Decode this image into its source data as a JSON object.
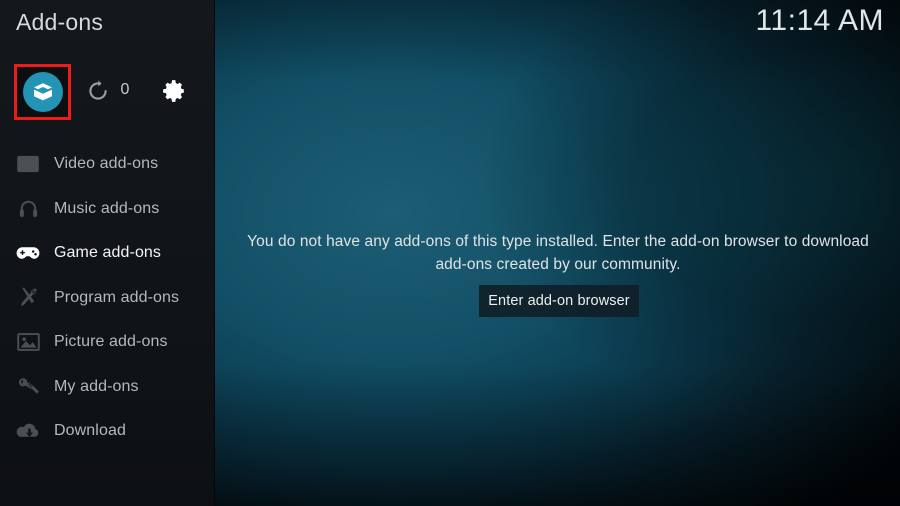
{
  "window": {
    "title": "Add-ons",
    "clock": "11:14 AM"
  },
  "toolbar": {
    "addon_browser": {
      "label": "",
      "icon": "addon-box-icon",
      "highlighted": true,
      "highlight_color": "#ee1b1b",
      "accent_color": "#2494b5"
    },
    "refresh": {
      "label": "",
      "icon": "refresh-icon",
      "count": "0"
    },
    "settings": {
      "label": "",
      "icon": "gear-icon"
    }
  },
  "sidebar": {
    "items": [
      {
        "label": "Video add-ons",
        "icon": "film-strip-icon",
        "selected": false
      },
      {
        "label": "Music add-ons",
        "icon": "headphones-icon",
        "selected": false
      },
      {
        "label": "Game add-ons",
        "icon": "gamepad-icon",
        "selected": true
      },
      {
        "label": "Program add-ons",
        "icon": "tools-icon",
        "selected": false
      },
      {
        "label": "Picture add-ons",
        "icon": "picture-icon",
        "selected": false
      },
      {
        "label": "My add-ons",
        "icon": "gear-wrench-icon",
        "selected": false
      },
      {
        "label": "Download",
        "icon": "cloud-download-icon",
        "selected": false
      }
    ]
  },
  "main": {
    "empty_message": "You do not have any add-ons of this type installed. Enter the add-on browser to download add-ons created by our community.",
    "enter_browser_label": "Enter add-on browser"
  },
  "colors": {
    "sidebar_bg": "#111519",
    "background_teal": "#1d5e74",
    "accent": "#2494b5",
    "highlight": "#ee1b1b",
    "text_primary": "#eceff1",
    "text_dim": "#b4b8bc"
  }
}
